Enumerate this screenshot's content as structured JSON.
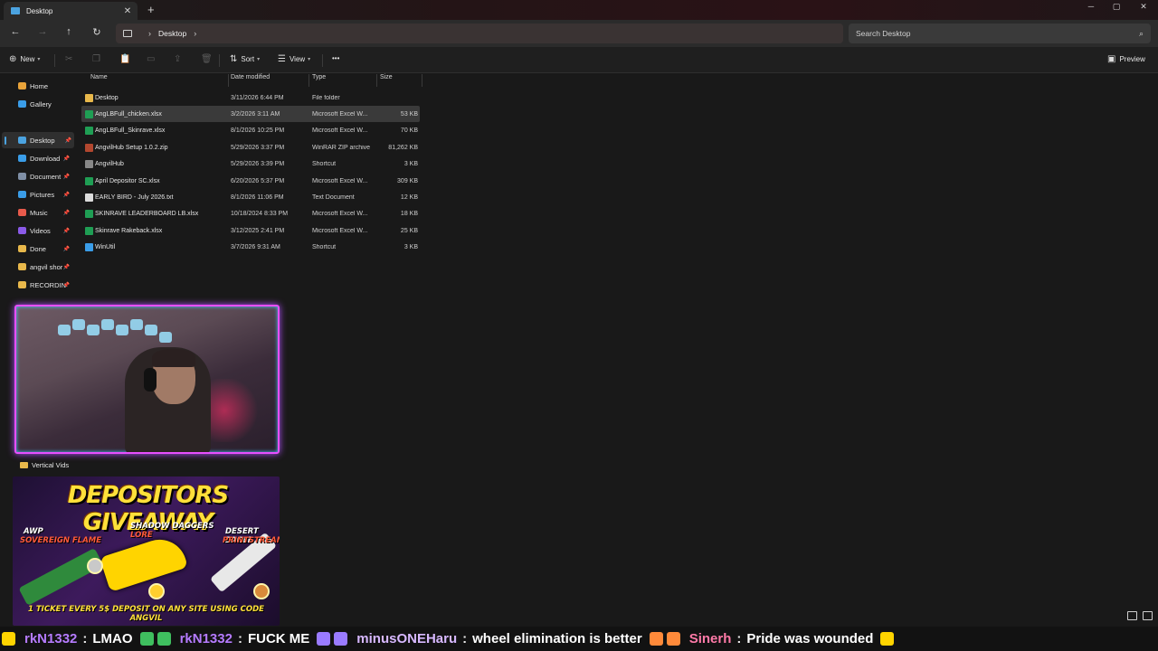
{
  "window": {
    "tab_title": "Desktop",
    "tab_close": "✕",
    "new_tab": "+",
    "minimize": "─",
    "maximize": "▢",
    "close": "✕"
  },
  "address": {
    "back": "←",
    "forward": "→",
    "up": "↑",
    "refresh": "↻",
    "chevron": "›",
    "crumb": "Desktop",
    "search_placeholder": "Search Desktop",
    "search_icon": "⌕"
  },
  "commands": {
    "new_label": "New",
    "sort_label": "Sort",
    "view_label": "View",
    "more": "•••",
    "preview_label": "Preview"
  },
  "sidebar": {
    "items": [
      {
        "label": "Home",
        "color": "#e8a33a"
      },
      {
        "label": "Gallery",
        "color": "#3a9de8"
      },
      {
        "label": "Desktop",
        "color": "#4ba3e0",
        "pin": "📌"
      },
      {
        "label": "Download",
        "color": "#3a9de8",
        "pin": "📌"
      },
      {
        "label": "Document",
        "color": "#7f8fa6",
        "pin": "📌"
      },
      {
        "label": "Pictures",
        "color": "#3a9de8",
        "pin": "📌"
      },
      {
        "label": "Music",
        "color": "#e85a4b",
        "pin": "📌"
      },
      {
        "label": "Videos",
        "color": "#8a5ae8",
        "pin": "📌"
      },
      {
        "label": "Done",
        "color": "#e8b84b",
        "pin": "📌"
      },
      {
        "label": "angvil shor",
        "color": "#e8b84b",
        "pin": "📌"
      },
      {
        "label": "RECORDIN",
        "color": "#e8b84b",
        "pin": "📌"
      }
    ],
    "vertical_vids": "Vertical Vids"
  },
  "columns": {
    "name": "Name",
    "date": "Date modified",
    "type": "Type",
    "size": "Size"
  },
  "files": [
    {
      "name": "Desktop",
      "date": "3/11/2026 6:44 PM",
      "type": "File folder",
      "size": "",
      "color": "#e8b84b"
    },
    {
      "name": "AngLBFull_chicken.xlsx",
      "date": "3/2/2026 3:11 AM",
      "type": "Microsoft Excel W...",
      "size": "53 KB",
      "color": "#1f9e54"
    },
    {
      "name": "AngLBFull_Skinrave.xlsx",
      "date": "8/1/2026 10:25 PM",
      "type": "Microsoft Excel W...",
      "size": "70 KB",
      "color": "#1f9e54"
    },
    {
      "name": "AngvilHub Setup 1.0.2.zip",
      "date": "5/29/2026 3:37 PM",
      "type": "WinRAR ZIP archive",
      "size": "81,262 KB",
      "color": "#b2472f"
    },
    {
      "name": "AngvilHub",
      "date": "5/29/2026 3:39 PM",
      "type": "Shortcut",
      "size": "3 KB",
      "color": "#888888"
    },
    {
      "name": "April Depositor SC.xlsx",
      "date": "6/20/2026 5:37 PM",
      "type": "Microsoft Excel W...",
      "size": "309 KB",
      "color": "#1f9e54"
    },
    {
      "name": "EARLY BIRD - July 2026.txt",
      "date": "8/1/2026 11:06 PM",
      "type": "Text Document",
      "size": "12 KB",
      "color": "#dcdcdc"
    },
    {
      "name": "SKINRAVE LEADERBOARD LB.xlsx",
      "date": "10/18/2024 8:33 PM",
      "type": "Microsoft Excel W...",
      "size": "18 KB",
      "color": "#1f9e54"
    },
    {
      "name": "Skinrave Rakeback.xlsx",
      "date": "3/12/2025 2:41 PM",
      "type": "Microsoft Excel W...",
      "size": "25 KB",
      "color": "#1f9e54"
    },
    {
      "name": "WinUtil",
      "date": "3/7/2026 9:31 AM",
      "type": "Shortcut",
      "size": "3 KB",
      "color": "#3a9de8"
    }
  ],
  "banner": {
    "title": "DEPOSITORS GIVEAWAY",
    "weapon_awp_1": "AWP",
    "weapon_awp_2": "SOVEREIGN FLAME",
    "weapon_shadow_1": "SHADOW DAGGERS",
    "weapon_shadow_2": "LORE",
    "weapon_deagle_1": "DESERT EAGLE",
    "weapon_deagle_2": "PRINTSTREAM",
    "footer": "1 TICKET EVERY 5$ DEPOSIT ON ANY SITE USING CODE ANGVIL"
  },
  "chat": [
    {
      "user": "rkN1332",
      "msg": "LMAO",
      "color": "#b57bff"
    },
    {
      "user": "rkN1332",
      "msg": "FUCK ME",
      "color": "#b57bff"
    },
    {
      "user": "minusONEHaru",
      "msg": "wheel elimination is better",
      "color": "#d7b8ff"
    },
    {
      "user": "Sinerh",
      "msg": "Pride was wounded",
      "color": "#ff7aa8"
    }
  ],
  "separator": ":"
}
